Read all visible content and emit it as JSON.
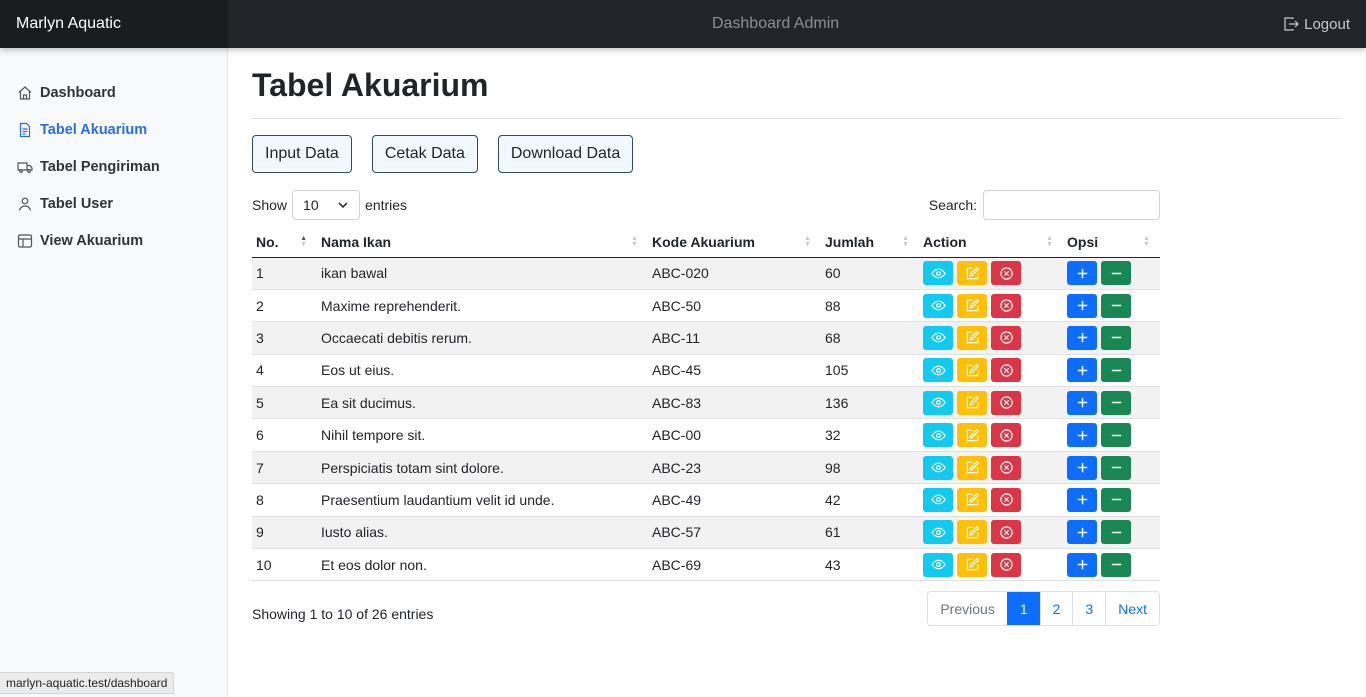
{
  "navbar": {
    "brand": "Marlyn Aquatic",
    "title": "Dashboard Admin",
    "logout_label": "Logout"
  },
  "sidebar": {
    "items": [
      {
        "label": "Dashboard",
        "icon": "house-icon"
      },
      {
        "label": "Tabel Akuarium",
        "icon": "file-text-icon",
        "active": true
      },
      {
        "label": "Tabel Pengiriman",
        "icon": "truck-icon"
      },
      {
        "label": "Tabel User",
        "icon": "person-icon"
      },
      {
        "label": "View Akuarium",
        "icon": "table-icon"
      }
    ]
  },
  "status_url": "marlyn-aquatic.test/dashboard",
  "page": {
    "title": "Tabel Akuarium",
    "buttons": {
      "input": "Input Data",
      "cetak": "Cetak Data",
      "download": "Download Data"
    }
  },
  "datatable": {
    "show_label": "Show",
    "entries_label": "entries",
    "page_length": "10",
    "search_label": "Search:",
    "search_value": "",
    "columns": [
      "No.",
      "Nama Ikan",
      "Kode Akuarium",
      "Jumlah",
      "Action",
      "Opsi"
    ],
    "rows": [
      [
        "1",
        "ikan bawal",
        "ABC-020",
        "60"
      ],
      [
        "2",
        "Maxime reprehenderit.",
        "ABC-50",
        "88"
      ],
      [
        "3",
        "Occaecati debitis rerum.",
        "ABC-11",
        "68"
      ],
      [
        "4",
        "Eos ut eius.",
        "ABC-45",
        "105"
      ],
      [
        "5",
        "Ea sit ducimus.",
        "ABC-83",
        "136"
      ],
      [
        "6",
        "Nihil tempore sit.",
        "ABC-00",
        "32"
      ],
      [
        "7",
        "Perspiciatis totam sint dolore.",
        "ABC-23",
        "98"
      ],
      [
        "8",
        "Praesentium laudantium velit id unde.",
        "ABC-49",
        "42"
      ],
      [
        "9",
        "Iusto alias.",
        "ABC-57",
        "61"
      ],
      [
        "10",
        "Et eos dolor non.",
        "ABC-69",
        "43"
      ]
    ],
    "info": "Showing 1 to 10 of 26 entries",
    "pagination": {
      "previous": "Previous",
      "pages": [
        "1",
        "2",
        "3"
      ],
      "active_page": "1",
      "next": "Next"
    }
  },
  "colors": {
    "info": "#12caf0",
    "warning": "#fdc007",
    "danger": "#dc3545",
    "primary": "#0d6efd",
    "success": "#198754",
    "sidebar_active": "#2b6fd6"
  }
}
